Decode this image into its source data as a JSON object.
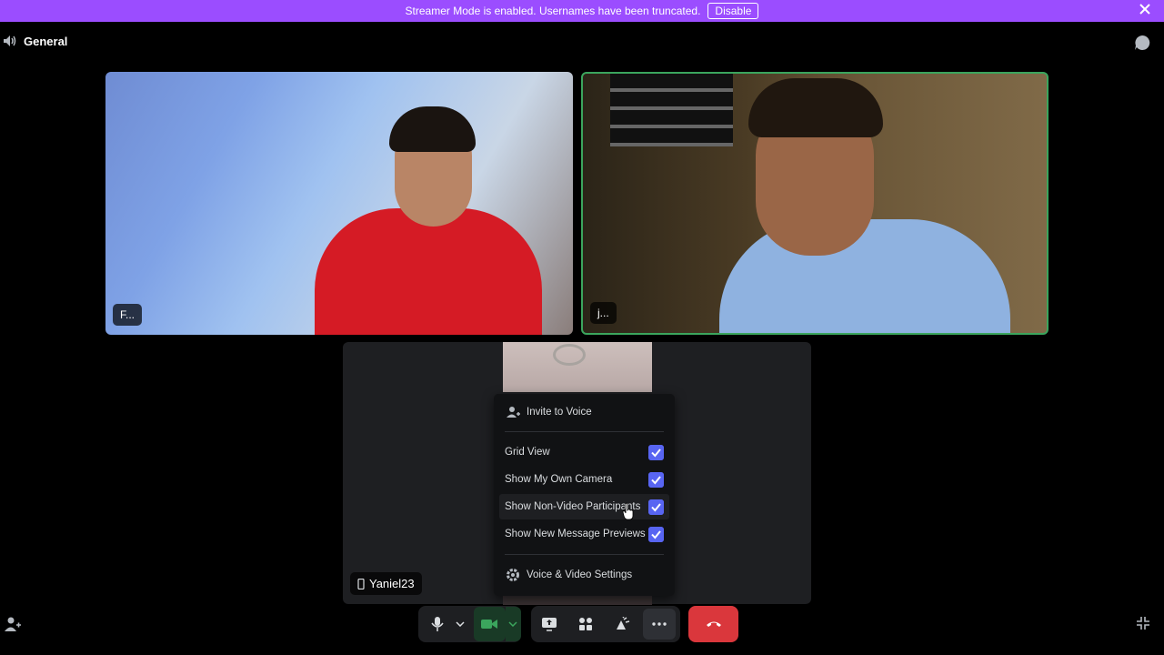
{
  "banner": {
    "message": "Streamer Mode is enabled. Usernames have been truncated.",
    "disable_label": "Disable",
    "background_color": "#9b4dff",
    "close_icon": "close-icon"
  },
  "header": {
    "channel_icon": "speaker-icon",
    "channel_name": "General",
    "chat_icon": "chat-bubble-icon"
  },
  "tiles": [
    {
      "name": "F...",
      "speaking": false
    },
    {
      "name": "j...",
      "speaking": true
    },
    {
      "name": "Yaniel23",
      "device_icon": "mobile-icon",
      "video": false
    }
  ],
  "menu": {
    "invite_label": "Invite to Voice",
    "items": [
      {
        "label": "Grid View",
        "checked": true
      },
      {
        "label": "Show My Own Camera",
        "checked": true
      },
      {
        "label": "Show Non-Video Participants",
        "checked": true
      },
      {
        "label": "Show New Message Previews",
        "checked": true
      }
    ],
    "settings_label": "Voice & Video Settings",
    "accent_color": "#5865f2"
  },
  "controls": {
    "mic_icon": "microphone-icon",
    "camera_icon": "camera-icon",
    "camera_on": true,
    "screen_share_icon": "screen-share-icon",
    "activities_icon": "activities-icon",
    "soundboard_icon": "soundboard-icon",
    "more_icon": "more-icon",
    "hangup_icon": "hang-up-icon",
    "hangup_color": "#da373c"
  }
}
